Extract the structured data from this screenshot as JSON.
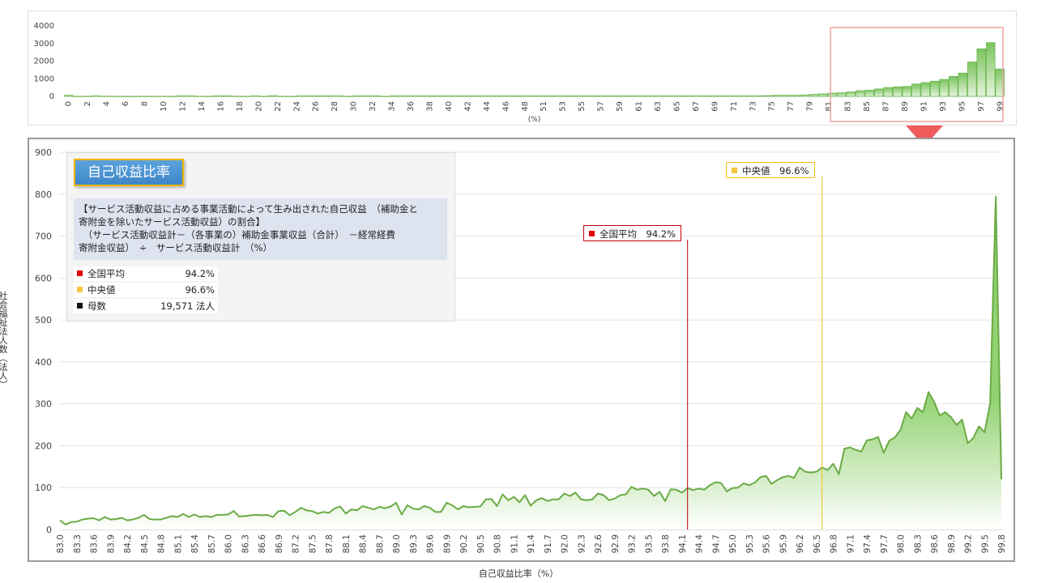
{
  "info": {
    "title": "自己収益比率",
    "desc_lines": [
      "【サービス活動収益に占める事業活動によって生み出された自己収益　（補助金と",
      "寄附金を除いたサービス活動収益）の割合】",
      "　（サービス活動収益計－（各事業の）補助金事業収益（合計）　－経常経費",
      "寄附金収益）　÷　サービス活動収益計　（%）"
    ],
    "rows": [
      {
        "label": "全国平均",
        "value": "94.2%",
        "color": "#e00000"
      },
      {
        "label": "中央値",
        "value": "96.6%",
        "color": "#f5c842"
      },
      {
        "label": "母数",
        "value": "19,571 法人",
        "color": "#111111"
      }
    ]
  },
  "markers": {
    "average_label": "全国平均　94.2%",
    "median_label": "中央値　96.6%",
    "average_value": 94.2,
    "median_value": 96.6,
    "average_color": "#c00000",
    "median_color": "#f0c020"
  },
  "axes": {
    "y_title": "社会福祉法人数（法人）",
    "x_title": "自己収益比率（%）"
  },
  "colors": {
    "bar_fill": "#6ab64f",
    "line": "#6aab45",
    "area_top": "#8ccf6a",
    "highlight_box": "#f0a3a3",
    "arrow": "#ef5b5b"
  },
  "chart_data": [
    {
      "type": "bar",
      "title": "",
      "xlabel": "(%)",
      "ylabel": "",
      "ylim": [
        0,
        4000
      ],
      "yticks": [
        0,
        1000,
        2000,
        3000,
        4000
      ],
      "x_tick_labels": [
        "0",
        "2",
        "4",
        "6",
        "8",
        "10",
        "12",
        "14",
        "16",
        "18",
        "20",
        "22",
        "24",
        "26",
        "28",
        "30",
        "32",
        "34",
        "36",
        "38",
        "40",
        "42",
        "44",
        "46",
        "48",
        "51",
        "53",
        "55",
        "57",
        "59",
        "61",
        "63",
        "65",
        "67",
        "69",
        "71",
        "73",
        "75",
        "77",
        "79",
        "81",
        "83",
        "85",
        "87",
        "89",
        "91",
        "93",
        "95",
        "97",
        "99"
      ],
      "bins": [
        0,
        1,
        2,
        3,
        4,
        5,
        6,
        7,
        8,
        9,
        10,
        11,
        12,
        13,
        14,
        15,
        16,
        17,
        18,
        19,
        20,
        21,
        22,
        23,
        24,
        25,
        26,
        27,
        28,
        29,
        30,
        31,
        32,
        33,
        34,
        35,
        36,
        37,
        38,
        39,
        40,
        41,
        42,
        43,
        44,
        45,
        46,
        47,
        48,
        49,
        50,
        51,
        52,
        53,
        54,
        55,
        56,
        57,
        58,
        59,
        60,
        61,
        62,
        63,
        64,
        65,
        66,
        67,
        68,
        69,
        70,
        71,
        72,
        73,
        74,
        75,
        76,
        77,
        78,
        79,
        80,
        81,
        82,
        83,
        84,
        85,
        86,
        87,
        88,
        89,
        90,
        91,
        92,
        93,
        94,
        95,
        96,
        97,
        98,
        99,
        100
      ],
      "values": [
        60,
        5,
        8,
        30,
        10,
        6,
        5,
        4,
        6,
        5,
        8,
        5,
        30,
        30,
        8,
        6,
        30,
        30,
        10,
        6,
        30,
        5,
        35,
        6,
        5,
        30,
        30,
        30,
        30,
        30,
        6,
        30,
        30,
        30,
        5,
        30,
        30,
        30,
        30,
        30,
        30,
        30,
        30,
        30,
        30,
        30,
        30,
        30,
        30,
        30,
        30,
        30,
        30,
        30,
        30,
        30,
        30,
        30,
        30,
        30,
        30,
        30,
        30,
        30,
        30,
        30,
        30,
        30,
        30,
        30,
        30,
        30,
        30,
        30,
        30,
        40,
        60,
        60,
        60,
        80,
        110,
        140,
        180,
        200,
        250,
        320,
        350,
        420,
        500,
        540,
        560,
        700,
        780,
        860,
        960,
        1130,
        1320,
        1950,
        2700,
        3050,
        1550
      ]
    },
    {
      "type": "area",
      "title": "",
      "xlabel": "自己収益比率（%）",
      "ylabel": "社会福祉法人数（法人）",
      "ylim": [
        0,
        900
      ],
      "yticks": [
        0,
        100,
        200,
        300,
        400,
        500,
        600,
        700,
        800,
        900
      ],
      "x_start": 83.0,
      "x_step": 0.1,
      "x_tick_labels": [
        "83.0",
        "83.3",
        "83.6",
        "83.9",
        "84.2",
        "84.5",
        "84.8",
        "85.1",
        "85.4",
        "85.7",
        "86.0",
        "86.3",
        "86.6",
        "86.9",
        "87.2",
        "87.5",
        "87.8",
        "88.1",
        "88.4",
        "88.7",
        "89.0",
        "89.3",
        "89.6",
        "89.9",
        "90.2",
        "90.5",
        "90.8",
        "91.1",
        "91.4",
        "91.7",
        "92.0",
        "92.3",
        "92.6",
        "92.9",
        "93.2",
        "93.5",
        "93.8",
        "94.1",
        "94.4",
        "94.7",
        "95.0",
        "95.3",
        "95.6",
        "95.9",
        "96.2",
        "96.5",
        "96.8",
        "97.1",
        "97.4",
        "97.7",
        "98.0",
        "98.3",
        "98.6",
        "98.9",
        "99.2",
        "99.5",
        "99.8"
      ],
      "values": [
        22,
        12,
        18,
        19,
        24,
        26,
        27,
        22,
        30,
        24,
        25,
        28,
        22,
        24,
        28,
        35,
        25,
        24,
        24,
        28,
        32,
        30,
        37,
        30,
        36,
        30,
        32,
        30,
        35,
        35,
        36,
        44,
        31,
        32,
        34,
        35,
        34,
        35,
        30,
        44,
        45,
        34,
        42,
        52,
        46,
        44,
        38,
        42,
        40,
        50,
        55,
        38,
        48,
        46,
        56,
        52,
        48,
        54,
        51,
        55,
        64,
        36,
        58,
        50,
        48,
        56,
        52,
        42,
        42,
        64,
        58,
        48,
        56,
        53,
        54,
        55,
        72,
        73,
        56,
        84,
        70,
        78,
        65,
        82,
        57,
        70,
        75,
        68,
        72,
        72,
        86,
        80,
        88,
        72,
        70,
        72,
        86,
        82,
        70,
        74,
        82,
        84,
        102,
        95,
        98,
        95,
        80,
        90,
        68,
        96,
        95,
        88,
        99,
        94,
        98,
        95,
        106,
        113,
        111,
        91,
        99,
        100,
        110,
        106,
        112,
        125,
        128,
        109,
        118,
        125,
        128,
        123,
        148,
        138,
        136,
        138,
        148,
        142,
        157,
        132,
        193,
        196,
        190,
        186,
        213,
        215,
        221,
        183,
        212,
        220,
        238,
        280,
        265,
        290,
        280,
        328,
        305,
        272,
        280,
        268,
        250,
        262,
        206,
        218,
        246,
        232,
        302,
        794,
        120
      ]
    }
  ]
}
